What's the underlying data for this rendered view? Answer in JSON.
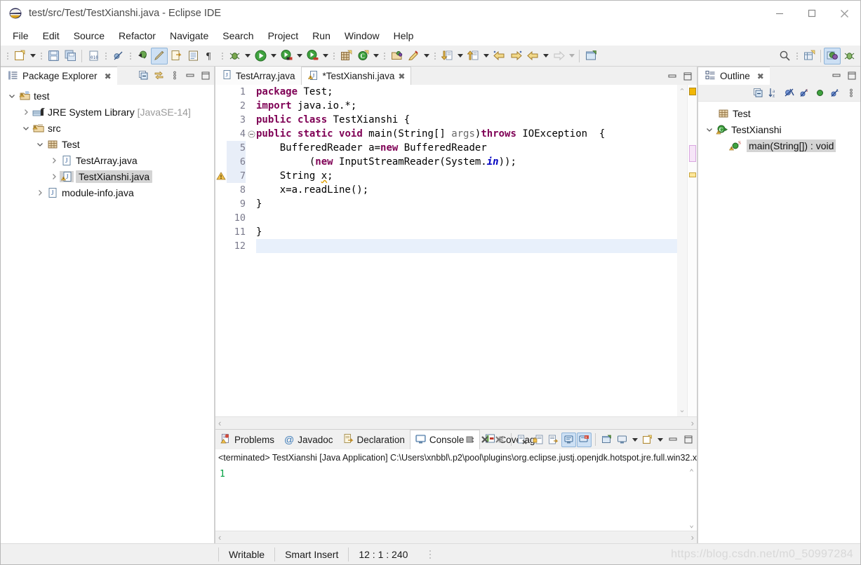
{
  "window": {
    "title": "test/src/Test/TestXianshi.java - Eclipse IDE",
    "logo_icon": "eclipse-logo-icon",
    "minimize_label": "—",
    "maximize_label": "□",
    "close_label": "✕"
  },
  "menubar": {
    "items": [
      {
        "label": "File"
      },
      {
        "label": "Edit"
      },
      {
        "label": "Source"
      },
      {
        "label": "Refactor"
      },
      {
        "label": "Navigate"
      },
      {
        "label": "Search"
      },
      {
        "label": "Project"
      },
      {
        "label": "Run"
      },
      {
        "label": "Window"
      },
      {
        "label": "Help"
      }
    ]
  },
  "toolbar": {
    "items": [
      {
        "name": "new-wizard-icon",
        "title": "New"
      },
      {
        "name": "new-dropdown-arrow",
        "title": "New menu"
      },
      {
        "name": "save-icon",
        "title": "Save"
      },
      {
        "name": "save-all-icon",
        "title": "Save All"
      },
      {
        "name": "toggle-breakpoint-icon",
        "title": "Toggle Breakpoint"
      },
      {
        "name": "skip-breakpoints-icon",
        "title": "Skip All Breakpoints"
      },
      {
        "name": "debug-last-icon",
        "title": "Debug Last Launched"
      },
      {
        "name": "java-editor-icon",
        "title": "Java Editor"
      },
      {
        "name": "open-type-icon",
        "title": "Open Type"
      },
      {
        "name": "open-task-icon",
        "title": "Open Task"
      },
      {
        "name": "paragraph-marks-icon",
        "title": "Show Whitespace"
      },
      {
        "name": "debug-icon",
        "title": "Debug"
      },
      {
        "name": "debug-dropdown-arrow",
        "title": "Debug menu"
      },
      {
        "name": "run-icon",
        "title": "Run"
      },
      {
        "name": "run-dropdown-arrow",
        "title": "Run menu"
      },
      {
        "name": "coverage-icon",
        "title": "Coverage"
      },
      {
        "name": "coverage-dropdown-arrow",
        "title": "Coverage menu"
      },
      {
        "name": "external-tools-icon",
        "title": "External Tools"
      },
      {
        "name": "external-tools-dropdown-arrow",
        "title": "External Tools menu"
      },
      {
        "name": "new-java-project-icon",
        "title": "New Java Project"
      },
      {
        "name": "new-class-icon",
        "title": "New Java Class"
      },
      {
        "name": "new-class-dropdown-arrow",
        "title": "New Class menu"
      },
      {
        "name": "open-package-icon",
        "title": "Open Package"
      },
      {
        "name": "quick-fix-icon",
        "title": "Quick Fix"
      },
      {
        "name": "quick-fix-dropdown-arrow",
        "title": "Quick Fix menu"
      },
      {
        "name": "previous-annotation-icon",
        "title": "Previous Annotation"
      },
      {
        "name": "previous-annotation-dropdown-arrow",
        "title": "Previous Annotation menu"
      },
      {
        "name": "next-annotation-icon",
        "title": "Next Annotation"
      },
      {
        "name": "next-annotation-dropdown-arrow",
        "title": "Next Annotation menu"
      },
      {
        "name": "back-icon",
        "title": "Back"
      },
      {
        "name": "forward-icon",
        "title": "Forward"
      },
      {
        "name": "last-edit-location-icon",
        "title": "Last Edit Location"
      },
      {
        "name": "last-edit-dropdown-arrow",
        "title": "Last Edit menu"
      },
      {
        "name": "forward-history-icon",
        "title": "Forward History"
      },
      {
        "name": "forward-history-dropdown-arrow",
        "title": "Forward History menu"
      },
      {
        "name": "new-window-icon",
        "title": "New Window"
      }
    ],
    "right_items": [
      {
        "name": "search-icon",
        "title": "Search"
      },
      {
        "name": "open-perspective-icon",
        "title": "Open Perspective"
      },
      {
        "name": "java-perspective-icon",
        "title": "Java Perspective"
      },
      {
        "name": "debug-perspective-icon",
        "title": "Debug Perspective"
      }
    ]
  },
  "package_explorer": {
    "tab_label": "Package Explorer",
    "tab_icon": "package-explorer-icon",
    "close_label": "✖",
    "actions": [
      {
        "name": "collapse-all-icon",
        "title": "Collapse All"
      },
      {
        "name": "link-with-editor-icon",
        "title": "Link with Editor"
      },
      {
        "name": "view-menu-icon",
        "title": "View Menu"
      },
      {
        "name": "minimize-icon",
        "title": "Minimize"
      },
      {
        "name": "maximize-icon",
        "title": "Maximize"
      }
    ],
    "tree": [
      {
        "label": "test",
        "suffix": "",
        "indent": 0,
        "twisty": "down",
        "icon": "java-project-warning-icon",
        "selected": false
      },
      {
        "label": "JRE System Library",
        "suffix": " [JavaSE-14]",
        "indent": 1,
        "twisty": "right",
        "icon": "jre-library-icon",
        "selected": false
      },
      {
        "label": "src",
        "suffix": "",
        "indent": 1,
        "twisty": "down",
        "icon": "source-folder-warning-icon",
        "selected": false
      },
      {
        "label": "Test",
        "suffix": "",
        "indent": 2,
        "twisty": "down",
        "icon": "package-icon",
        "selected": false
      },
      {
        "label": "TestArray.java",
        "suffix": "",
        "indent": 3,
        "twisty": "right",
        "icon": "java-file-icon",
        "selected": false
      },
      {
        "label": "TestXianshi.java",
        "suffix": "",
        "indent": 3,
        "twisty": "right",
        "icon": "java-file-warning-icon",
        "selected": true
      },
      {
        "label": "module-info.java",
        "suffix": "",
        "indent": 2,
        "twisty": "right",
        "icon": "java-file-icon",
        "selected": false
      }
    ]
  },
  "editor": {
    "tabs": [
      {
        "label": "TestArray.java",
        "icon": "java-file-icon",
        "active": false,
        "closable": false
      },
      {
        "label": "*TestXianshi.java",
        "icon": "java-file-warning-icon",
        "active": true,
        "closable": true,
        "close_label": "✖"
      }
    ],
    "actions": [
      {
        "name": "minimize-icon",
        "title": "Minimize"
      },
      {
        "name": "maximize-icon",
        "title": "Maximize"
      }
    ],
    "current_line": 12,
    "selected_line_range": [
      5,
      7
    ],
    "warning_line": 7,
    "fold_line": 4,
    "lines": [
      {
        "n": 1,
        "text": "package Test;"
      },
      {
        "n": 2,
        "text": "import java.io.*;"
      },
      {
        "n": 3,
        "text": "public class TestXianshi {"
      },
      {
        "n": 4,
        "text": "public static void main(String[] args)throws IOException  {"
      },
      {
        "n": 5,
        "text": "    BufferedReader a=new BufferedReader"
      },
      {
        "n": 6,
        "text": "         (new InputStreamReader(System.in));"
      },
      {
        "n": 7,
        "text": "    String x;"
      },
      {
        "n": 8,
        "text": "    x=a.readLine();"
      },
      {
        "n": 9,
        "text": "}"
      },
      {
        "n": 10,
        "text": ""
      },
      {
        "n": 11,
        "text": "}"
      },
      {
        "n": 12,
        "text": ""
      }
    ],
    "scroll_up_label": "⌃",
    "scroll_down_label": "⌄",
    "hscroll_left_label": "‹",
    "hscroll_right_label": "›"
  },
  "outline": {
    "tab_label": "Outline",
    "tab_icon": "outline-icon",
    "close_label": "✖",
    "actions": [
      {
        "name": "collapse-all-icon",
        "title": "Collapse All"
      },
      {
        "name": "sort-icon",
        "title": "Sort"
      },
      {
        "name": "hide-fields-icon",
        "title": "Hide Fields"
      },
      {
        "name": "hide-static-icon",
        "title": "Hide Static Members"
      },
      {
        "name": "hide-nonpublic-icon",
        "title": "Hide Non-Public Members"
      },
      {
        "name": "hide-local-types-icon",
        "title": "Hide Local Types"
      },
      {
        "name": "view-menu-icon",
        "title": "View Menu"
      }
    ],
    "panel_actions": [
      {
        "name": "minimize-icon",
        "title": "Minimize"
      },
      {
        "name": "maximize-icon",
        "title": "Maximize"
      }
    ],
    "items": [
      {
        "label": "Test",
        "indent": 1,
        "twisty": "",
        "icon": "package-icon",
        "selected": false
      },
      {
        "label": "TestXianshi",
        "indent": 0,
        "twisty": "down",
        "icon": "class-warning-icon",
        "selected": false
      },
      {
        "label": "main(String[]) : void",
        "indent": 2,
        "twisty": "",
        "icon": "method-static-warning-icon",
        "selected": true
      }
    ]
  },
  "console": {
    "tabs": [
      {
        "label": "Problems",
        "icon": "problems-icon",
        "active": false,
        "closable": false
      },
      {
        "label": "Javadoc",
        "icon": "javadoc-icon",
        "active": false,
        "closable": false
      },
      {
        "label": "Declaration",
        "icon": "declaration-icon",
        "active": false,
        "closable": false
      },
      {
        "label": "Console",
        "icon": "console-icon",
        "active": true,
        "closable": true,
        "close_label": "✖"
      },
      {
        "label": "Coverage",
        "icon": "coverage-icon",
        "active": false,
        "closable": false
      }
    ],
    "actions": [
      {
        "name": "terminate-icon",
        "title": "Terminate"
      },
      {
        "name": "remove-launch-icon",
        "title": "Remove Launch"
      },
      {
        "name": "remove-all-terminated-icon",
        "title": "Remove All Terminated Launches"
      },
      {
        "name": "clear-console-icon",
        "title": "Clear Console"
      },
      {
        "name": "scroll-lock-icon",
        "title": "Scroll Lock"
      },
      {
        "name": "word-wrap-icon",
        "title": "Word Wrap"
      },
      {
        "name": "pin-console-icon",
        "title": "Pin Console"
      },
      {
        "name": "display-selected-console-icon",
        "title": "Display Selected Console"
      },
      {
        "name": "display-console-dropdown-arrow",
        "title": "Display Console menu"
      },
      {
        "name": "open-console-icon",
        "title": "Open Console"
      },
      {
        "name": "open-console-dropdown-arrow",
        "title": "Open Console menu"
      },
      {
        "name": "minimize-icon",
        "title": "Minimize"
      },
      {
        "name": "maximize-icon",
        "title": "Maximize"
      }
    ],
    "header": "<terminated> TestXianshi [Java Application] C:\\Users\\xnbbl\\.p2\\pool\\plugins\\org.eclipse.justj.openjdk.hotspot.jre.full.win32.x",
    "output": "1",
    "scroll_up_label": "⌃",
    "scroll_down_label": "⌄",
    "hscroll_left_label": "‹",
    "hscroll_right_label": "›"
  },
  "statusbar": {
    "writable": "Writable",
    "insert_mode": "Smart Insert",
    "position": "12 : 1 : 240",
    "watermark": "https://blog.csdn.net/m0_50997284"
  },
  "colors": {
    "keyword": "#7f0055",
    "field": "#0000c0",
    "selection": "#e8f0fb",
    "accent": "#cde0f4",
    "console_text": "#00a040",
    "warning": "#e0a000"
  }
}
